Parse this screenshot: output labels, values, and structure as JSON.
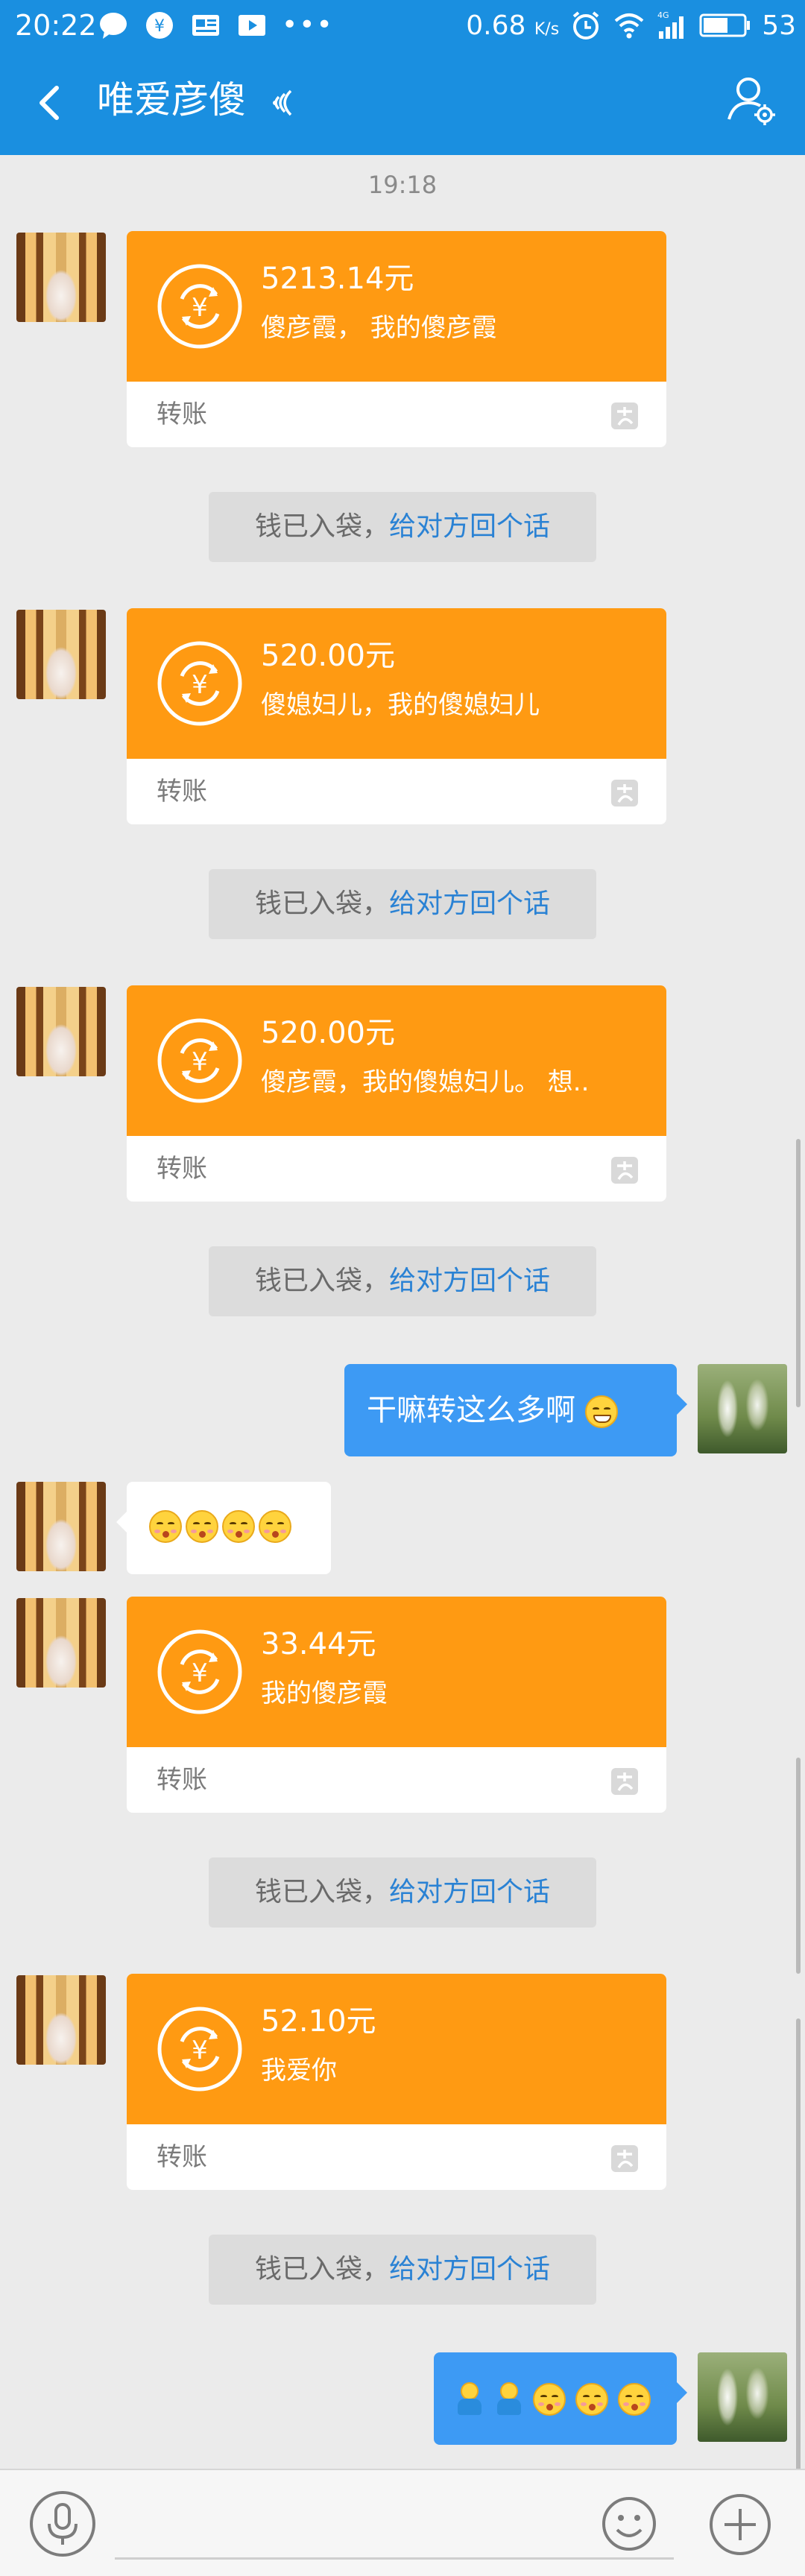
{
  "status_bar": {
    "time": "20:22",
    "speed_value": "0.68",
    "speed_unit": "K/s",
    "network": "4G",
    "battery": "53"
  },
  "header": {
    "title": "唯爱彦傻",
    "back_icon": "back-arrow-icon",
    "profile_icon": "profile-settings-icon"
  },
  "chat": {
    "timestamp": "19:18",
    "transfers": [
      {
        "amount": "5213.14元",
        "memo": "傻彦霞，  我的傻彦霞",
        "label": "转账"
      },
      {
        "amount": "520.00元",
        "memo": "傻媳妇儿，我的傻媳妇儿",
        "label": "转账"
      },
      {
        "amount": "520.00元",
        "memo": "傻彦霞，我的傻媳妇儿。 想..",
        "label": "转账"
      },
      {
        "amount": "33.44元",
        "memo": "我的傻彦霞",
        "label": "转账"
      },
      {
        "amount": "52.10元",
        "memo": "我爱你",
        "label": "转账"
      }
    ],
    "notice": {
      "text": "钱已入袋，",
      "link": "给对方回个话"
    },
    "my_message_1": "干嘛转这么多啊",
    "her_emoji_message": [
      "kissing-face-emoji",
      "kissing-face-emoji",
      "kissing-face-emoji",
      "kissing-face-emoji"
    ],
    "my_emoji_message": [
      "hugging-figure-emoji",
      "hugging-figure-emoji",
      "kissing-face-emoji",
      "kissing-face-emoji",
      "kissing-face-emoji"
    ]
  },
  "input_bar": {
    "voice_icon": "microphone-icon",
    "emoji_icon": "smiley-icon",
    "plus_icon": "plus-icon"
  },
  "colors": {
    "title_bar": "#1a8fe0",
    "transfer_card": "#ff9a12",
    "my_bubble": "#3d9af4",
    "notice_link": "#2a82d4",
    "background": "#ebebeb"
  }
}
